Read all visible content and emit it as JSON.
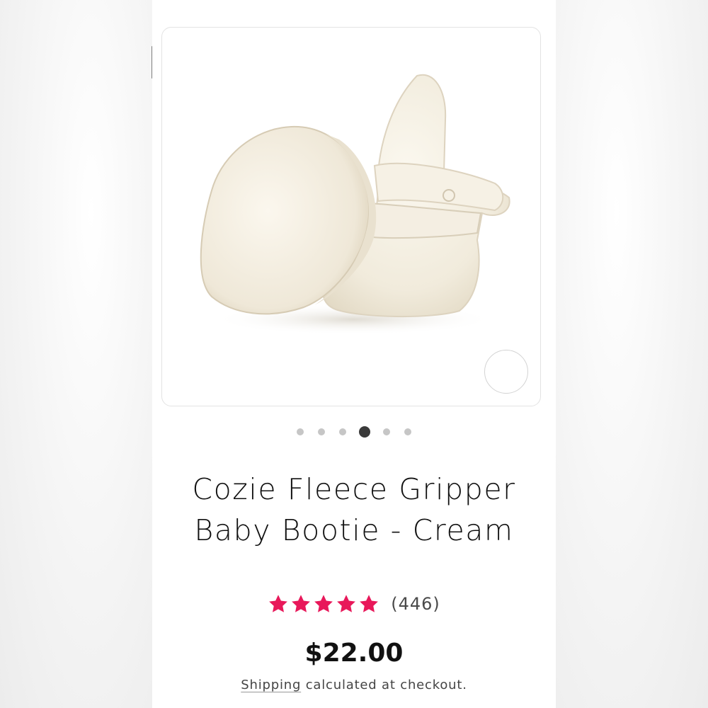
{
  "product": {
    "title_line1": "Cozie Fleece Gripper",
    "title_line2": "Baby Bootie - Cream",
    "rating": 5,
    "rating_max": 5,
    "review_count": "(446)",
    "price": "$22.00",
    "shipping_link": "Shipping",
    "shipping_rest": " calculated at checkout.",
    "image_alt": "cream fleece baby booties"
  },
  "gallery": {
    "slide_count": 6,
    "active_slide": 4
  },
  "colors": {
    "star": "#e8185a",
    "active_dot": "#3a3a3a",
    "inactive_dot": "#c6c6c6"
  }
}
